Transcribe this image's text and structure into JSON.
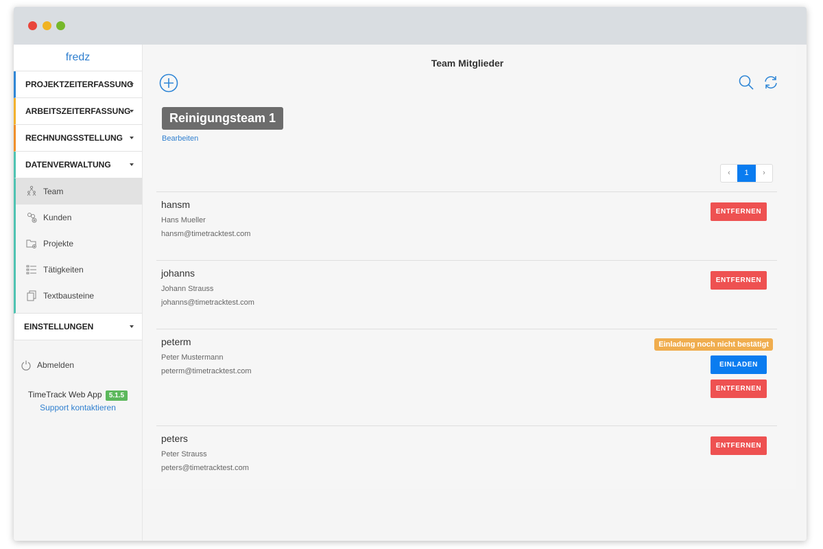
{
  "sidebar": {
    "brand": "fredz",
    "sections": [
      {
        "label": "PROJEKTZEITERFASSUNG",
        "color": "#2f86d6"
      },
      {
        "label": "ARBEITSZEITERFASSUNG",
        "color": "#f2b12e"
      },
      {
        "label": "RECHNUNGSSTELLUNG",
        "color": "#f08f2a"
      },
      {
        "label": "DATENVERWALTUNG",
        "color": "#4fc3b2"
      }
    ],
    "subitems": [
      {
        "label": "Team",
        "icon": "team-icon"
      },
      {
        "label": "Kunden",
        "icon": "customers-icon"
      },
      {
        "label": "Projekte",
        "icon": "projects-icon"
      },
      {
        "label": "Tätigkeiten",
        "icon": "activities-icon"
      },
      {
        "label": "Textbausteine",
        "icon": "text-blocks-icon"
      }
    ],
    "settings": "EINSTELLUNGEN",
    "logout": "Abmelden",
    "app_name": "TimeTrack Web App",
    "version": "5.1.5",
    "support": "Support kontaktieren"
  },
  "header": {
    "title": "Team Mitglieder"
  },
  "team": {
    "name": "Reinigungsteam 1",
    "edit_label": "Bearbeiten"
  },
  "pagination": {
    "prev": "‹",
    "current": "1",
    "next": "›"
  },
  "members": [
    {
      "username": "hansm",
      "full_name": "Hans Mueller",
      "email": "hansm@timetracktest.com",
      "remove_label": "ENTFERNEN"
    },
    {
      "username": "johanns",
      "full_name": "Johann Strauss",
      "email": "johanns@timetracktest.com",
      "remove_label": "ENTFERNEN"
    },
    {
      "username": "peterm",
      "full_name": "Peter Mustermann",
      "email": "peterm@timetracktest.com",
      "status": "Einladung noch nicht bestätigt",
      "invite_label": "EINLADEN",
      "remove_label": "ENTFERNEN"
    },
    {
      "username": "peters",
      "full_name": "Peter Strauss",
      "email": "peters@timetracktest.com",
      "remove_label": "ENTFERNEN"
    }
  ],
  "colors": {
    "accent": "#0a7cf0",
    "danger": "#ee5151",
    "warning": "#f0ad4e",
    "success": "#5cb85c"
  }
}
